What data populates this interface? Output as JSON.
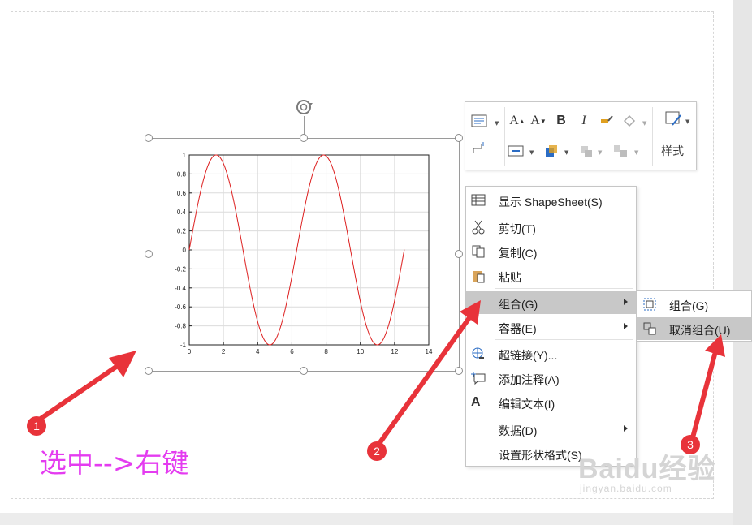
{
  "colors": {
    "curve": "#dd1f1f",
    "menu_highlight": "#c8c8c8",
    "annotation_text": "#e43cf0",
    "arrow": "#e8333a"
  },
  "mini_toolbar": {
    "buttons": [
      {
        "id": "text-block",
        "icon": "text-block-icon"
      },
      {
        "id": "font-grow",
        "label": "A",
        "icon": "font-grow-icon"
      },
      {
        "id": "font-shrink",
        "label": "A",
        "icon": "font-shrink-icon"
      },
      {
        "id": "bold",
        "label": "B",
        "icon": "bold-icon"
      },
      {
        "id": "italic",
        "label": "I",
        "icon": "italic-icon"
      },
      {
        "id": "format-painter",
        "icon": "format-painter-icon"
      },
      {
        "id": "fill",
        "icon": "fill-icon"
      },
      {
        "id": "connector",
        "icon": "connector-icon"
      },
      {
        "id": "align",
        "icon": "align-icon"
      },
      {
        "id": "bring-forward",
        "icon": "bring-forward-icon"
      },
      {
        "id": "send-backward",
        "icon": "send-backward-icon"
      },
      {
        "id": "group",
        "icon": "group-icon"
      },
      {
        "id": "styles",
        "icon": "styles-icon"
      }
    ],
    "style_label": "样式"
  },
  "context_menu": {
    "items": [
      {
        "label": "显示 ShapeSheet(S)",
        "icon": "shapesheet-icon"
      },
      {
        "label": "剪切(T)",
        "icon": "cut-icon"
      },
      {
        "label": "复制(C)",
        "icon": "copy-icon"
      },
      {
        "label": "粘贴",
        "icon": "paste-icon"
      },
      {
        "label": "组合(G)",
        "icon": "",
        "submenu": true,
        "highlighted": true
      },
      {
        "label": "容器(E)",
        "icon": "",
        "submenu": true
      },
      {
        "label": "超链接(Y)...",
        "icon": "hyperlink-icon"
      },
      {
        "label": "添加注释(A)",
        "icon": "comment-icon"
      },
      {
        "label": "编辑文本(I)",
        "icon": "edit-text-icon"
      },
      {
        "label": "数据(D)",
        "icon": "",
        "submenu": true
      },
      {
        "label": "设置形状格式(S)",
        "icon": ""
      }
    ]
  },
  "group_submenu": {
    "items": [
      {
        "label": "组合(G)",
        "icon": "group-icon"
      },
      {
        "label": "取消组合(U)",
        "icon": "ungroup-icon",
        "highlighted": true
      }
    ]
  },
  "annotation": {
    "text": "选中-->右键",
    "badges": [
      "1",
      "2",
      "3"
    ]
  },
  "watermark": {
    "text": "Baidu经验",
    "sub": "jingyan.baidu.com"
  },
  "chart_data": {
    "type": "line",
    "function": "sin(x)",
    "x_range": [
      0,
      12.57
    ],
    "xlim": [
      0,
      14
    ],
    "ylim": [
      -1,
      1
    ],
    "xticks": [
      "0",
      "2",
      "4",
      "6",
      "8",
      "10",
      "12",
      "14"
    ],
    "yticks": [
      "1",
      "0.8",
      "0.6",
      "0.4",
      "0.2",
      "0",
      "-0.2",
      "-0.4",
      "-0.6",
      "-0.8",
      "-1"
    ],
    "grid": true,
    "series": [
      {
        "x": [
          0,
          0.785,
          1.571,
          2.356,
          3.142,
          3.927,
          4.712,
          5.498,
          6.283,
          7.069,
          7.854,
          8.639,
          9.425,
          10.21,
          10.996,
          11.781,
          12.566
        ],
        "y": [
          0,
          0.707,
          1,
          0.707,
          0,
          -0.707,
          -1,
          -0.707,
          0,
          0.707,
          1,
          0.707,
          0,
          -0.707,
          -1,
          -0.707,
          0
        ]
      }
    ]
  }
}
